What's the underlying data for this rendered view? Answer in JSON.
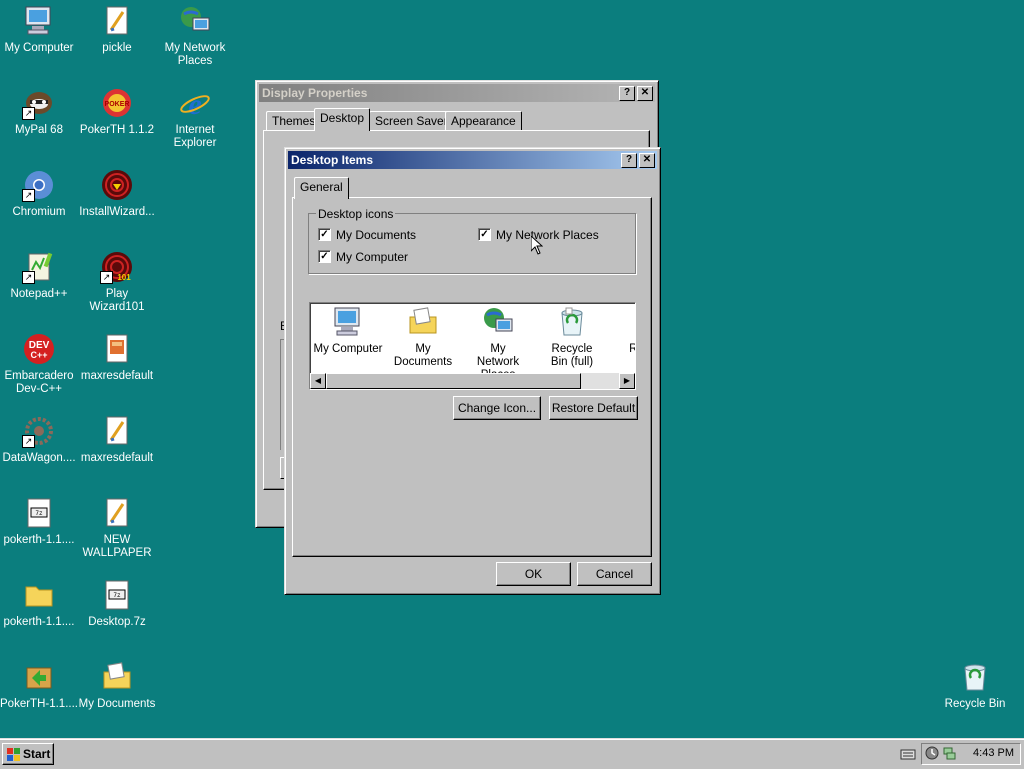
{
  "desktop_icons": [
    {
      "label": "My Computer",
      "icon": "my-computer-icon"
    },
    {
      "label": "pickle",
      "icon": "image-file-icon"
    },
    {
      "label": "My Network Places",
      "icon": "network-places-icon"
    },
    {
      "label": "MyPal 68",
      "icon": "mypal-icon"
    },
    {
      "label": "PokerTH 1.1.2",
      "icon": "pokerth-icon"
    },
    {
      "label": "Internet Explorer",
      "icon": "internet-explorer-icon"
    },
    {
      "label": "Chromium",
      "icon": "chromium-icon"
    },
    {
      "label": "InstallWizard...",
      "icon": "installwizard-icon"
    },
    {
      "label": "Notepad++",
      "icon": "notepadpp-icon"
    },
    {
      "label": "Play Wizard101",
      "icon": "wizard101-icon"
    },
    {
      "label": "Embarcadero Dev-C++",
      "icon": "devcpp-icon"
    },
    {
      "label": "maxresdefault",
      "icon": "image-file-icon"
    },
    {
      "label": "DataWagon....",
      "icon": "datawagon-icon"
    },
    {
      "label": "maxresdefault",
      "icon": "image-file-icon"
    },
    {
      "label": "pokerth-1.1....",
      "icon": "archive-file-icon"
    },
    {
      "label": "NEW WALLPAPER",
      "icon": "image-file-icon"
    },
    {
      "label": "pokerth-1.1....",
      "icon": "folder-icon"
    },
    {
      "label": "Desktop.7z",
      "icon": "archive-file-icon"
    },
    {
      "label": "PokerTH-1.1....",
      "icon": "pokerth-installer-icon"
    },
    {
      "label": "My Documents",
      "icon": "my-documents-icon"
    },
    {
      "label": "Recycle Bin",
      "icon": "recycle-bin-icon"
    }
  ],
  "display_properties": {
    "title": "Display Properties",
    "help": "?",
    "close": "✕",
    "tabs": [
      "Themes",
      "Desktop",
      "Screen Saver",
      "Appearance"
    ],
    "active_tab": "Desktop",
    "partial_label": "B"
  },
  "desktop_items": {
    "title": "Desktop Items",
    "help": "?",
    "close": "✕",
    "tab": "General",
    "group_label": "Desktop icons",
    "checkboxes": [
      {
        "label": "My Documents",
        "checked": true
      },
      {
        "label": "My Network Places",
        "checked": true
      },
      {
        "label": "My Computer",
        "checked": true
      }
    ],
    "check_mark": "✓",
    "preview_items": [
      {
        "label": "My Computer",
        "icon": "my-computer-icon"
      },
      {
        "label": "My Documents",
        "icon": "my-documents-icon"
      },
      {
        "label": "My Network Places",
        "icon": "network-places-icon"
      },
      {
        "label": "Recycle Bin (full)",
        "icon": "recycle-bin-full-icon"
      },
      {
        "label": "Rec (e",
        "icon": "recycle-bin-empty-icon"
      }
    ],
    "change_icon": "Change Icon...",
    "restore_default": "Restore Default",
    "ok": "OK",
    "cancel": "Cancel"
  },
  "taskbar": {
    "start": "Start",
    "clock": "4:43 PM"
  }
}
